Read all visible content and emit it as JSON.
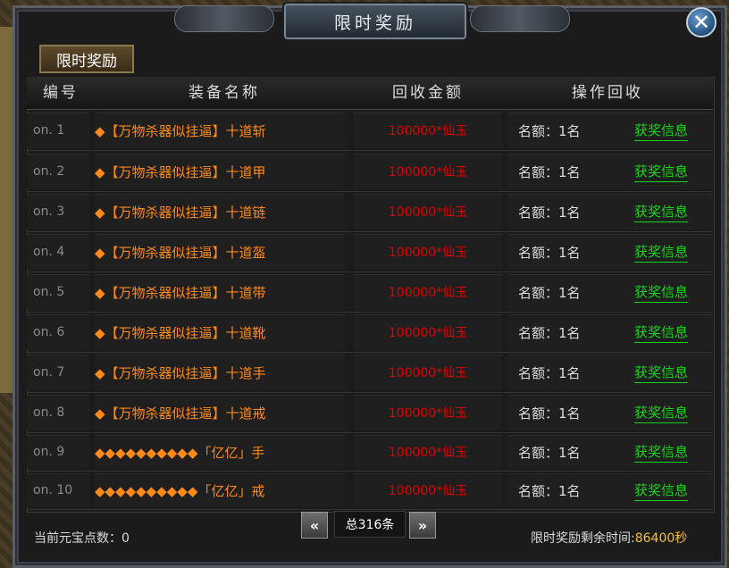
{
  "window": {
    "title": "限时奖励",
    "close_label": "✕",
    "tab_label": "限时奖励"
  },
  "table": {
    "headers": [
      "编号",
      "装备名称",
      "回收金额",
      "操作回收"
    ],
    "rows": [
      {
        "no": "on. 1",
        "name": "◆【万物杀器似挂逼】十道斩",
        "price": "100000*仙玉",
        "quota": "名额：1名",
        "action": "获奖信息"
      },
      {
        "no": "on. 2",
        "name": "◆【万物杀器似挂逼】十道甲",
        "price": "100000*仙玉",
        "quota": "名额：1名",
        "action": "获奖信息"
      },
      {
        "no": "on. 3",
        "name": "◆【万物杀器似挂逼】十道链",
        "price": "100000*仙玉",
        "quota": "名额：1名",
        "action": "获奖信息"
      },
      {
        "no": "on. 4",
        "name": "◆【万物杀器似挂逼】十道盔",
        "price": "100000*仙玉",
        "quota": "名额：1名",
        "action": "获奖信息"
      },
      {
        "no": "on. 5",
        "name": "◆【万物杀器似挂逼】十道带",
        "price": "100000*仙玉",
        "quota": "名额：1名",
        "action": "获奖信息"
      },
      {
        "no": "on. 6",
        "name": "◆【万物杀器似挂逼】十道靴",
        "price": "100000*仙玉",
        "quota": "名额：1名",
        "action": "获奖信息"
      },
      {
        "no": "on. 7",
        "name": "◆【万物杀器似挂逼】十道手",
        "price": "100000*仙玉",
        "quota": "名额：1名",
        "action": "获奖信息"
      },
      {
        "no": "on. 8",
        "name": "◆【万物杀器似挂逼】十道戒",
        "price": "100000*仙玉",
        "quota": "名额：1名",
        "action": "获奖信息"
      },
      {
        "no": "on. 9",
        "name": "◆◆◆◆◆◆◆◆◆◆「亿亿」手",
        "price": "100000*仙玉",
        "quota": "名额：1名",
        "action": "获奖信息"
      },
      {
        "no": "on. 10",
        "name": "◆◆◆◆◆◆◆◆◆◆「亿亿」戒",
        "price": "100000*仙玉",
        "quota": "名额：1名",
        "action": "获奖信息"
      }
    ]
  },
  "footer": {
    "points_label": "当前元宝点数：0",
    "prev_label": "«",
    "next_label": "»",
    "total_label": "总316条",
    "timer_label": "限时奖励剩余时间:",
    "timer_value": "86400秒"
  },
  "colors": {
    "item_name": "#ff8a18",
    "price": "#e00000",
    "link": "#19d419",
    "timer_value": "#f0c040"
  }
}
